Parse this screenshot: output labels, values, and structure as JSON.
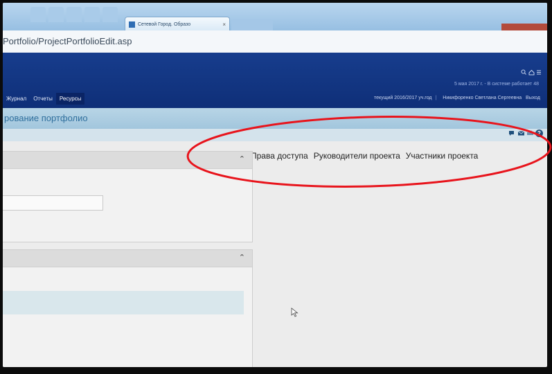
{
  "browser": {
    "tab_title": "Сетевой Город. Образо",
    "tab_close": "×",
    "url_fragment": "Portfolio/ProjectPortfolioEdit.asp"
  },
  "header": {
    "date_status": "5 мая 2017 г. - В системе работает 48",
    "school_year": "текущий 2016/2017 уч.год",
    "user_name": "Никифоренко Светлана Сергеевна",
    "logout": "Выход",
    "nav": [
      {
        "label": "Журнал"
      },
      {
        "label": "Отчеты"
      },
      {
        "label": "Ресурсы"
      }
    ]
  },
  "page": {
    "title": "рование портфолио"
  },
  "links": {
    "access_rights": "Права доступа",
    "project_leaders": "Руководители проекта",
    "project_members": "Участники проекта"
  },
  "colors": {
    "header_blue": "#173d8d",
    "title_blue": "#2f6f9d",
    "annotation_red": "#e8141c"
  },
  "icons": [
    "user-icon",
    "chat-icon",
    "mail-icon",
    "print-icon",
    "help-icon",
    "chevron-up-icon",
    "arrow-cursor"
  ]
}
